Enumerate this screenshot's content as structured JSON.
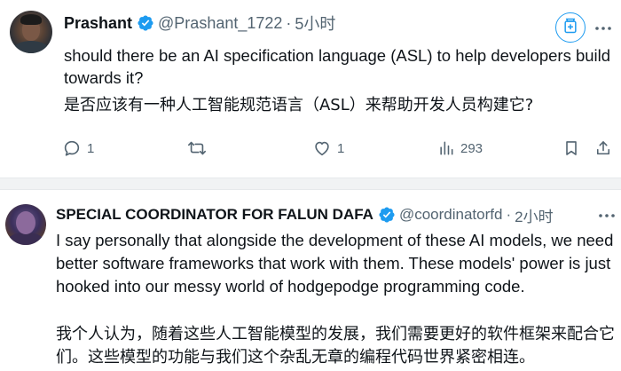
{
  "tweets": [
    {
      "author": {
        "name": "Prashant",
        "handle": "@Prashant_1722",
        "separator": "·",
        "time": "5小时"
      },
      "body": {
        "english": "should there be an AI specification language (ASL) to help developers build towards it?",
        "translation": "是否应该有一种人工智能规范语言（ASL）来帮助开发人员构建它?"
      },
      "actions": {
        "replies": "1",
        "retweets": "",
        "likes": "1",
        "views": "293"
      }
    },
    {
      "author": {
        "name": "SPECIAL COORDINATOR FOR FALUN DAFA",
        "handle": "@coordinatorfd",
        "separator": "·",
        "time": "2小时"
      },
      "body": {
        "english": "I say personally that alongside the development of these AI models, we need better software frameworks that work with them.  These models' power is just hooked into our messy world of hodgepodge programming code.",
        "translation": "我个人认为，随着这些人工智能模型的发展，我们需要更好的软件框架来配合它们。这些模型的功能与我们这个杂乱无章的编程代码世界紧密相连。"
      }
    }
  ],
  "icons": {
    "verified": "verified-badge-icon",
    "grok": "grok-translate-icon",
    "more": "more-dots-icon",
    "reply": "reply-icon",
    "retweet": "retweet-icon",
    "like": "heart-icon",
    "views": "views-chart-icon",
    "bookmark": "bookmark-icon",
    "share": "share-icon"
  },
  "colors": {
    "text_primary": "#0f1419",
    "text_secondary": "#536471",
    "accent": "#1d9bf0",
    "separator": "#f1f3f4"
  }
}
